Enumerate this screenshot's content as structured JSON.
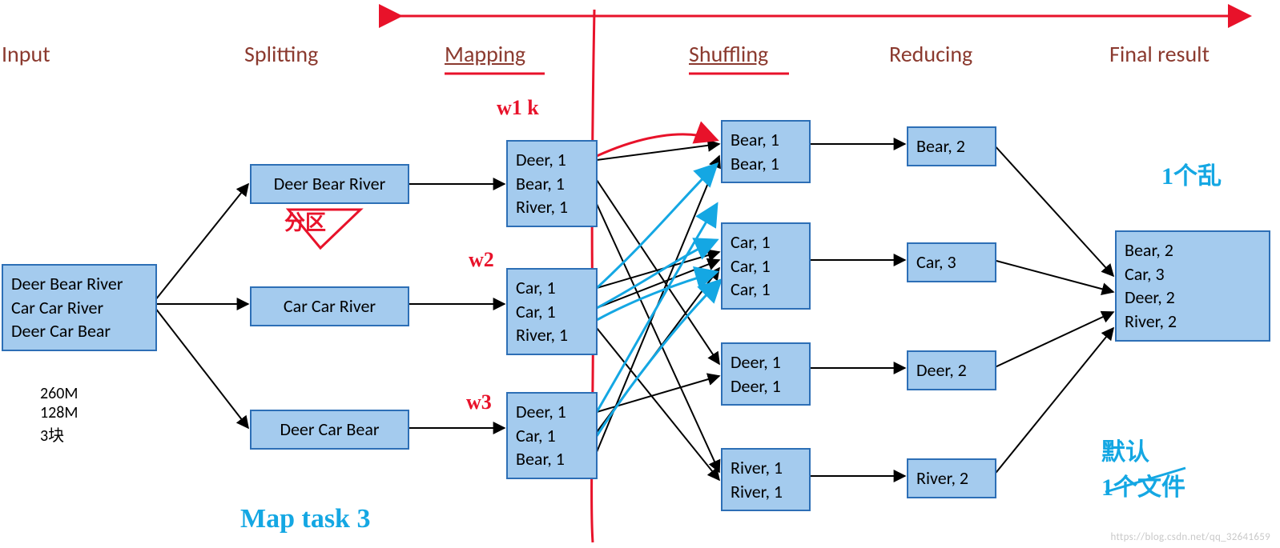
{
  "headers": {
    "input": "Input",
    "splitting": "Splitting",
    "mapping": "Mapping",
    "shuffling": "Shuffling",
    "reducing": "Reducing",
    "final": "Final result"
  },
  "boxes": {
    "input": "Deer Bear River\nCar Car River\nDeer Car Bear",
    "split1": "Deer Bear River",
    "split2": "Car Car River",
    "split3": "Deer Car Bear",
    "map1": "Deer, 1\nBear, 1\nRiver, 1",
    "map2": "Car, 1\nCar, 1\nRiver, 1",
    "map3": "Deer, 1\nCar, 1\nBear, 1",
    "shuf1": "Bear, 1\nBear, 1",
    "shuf2": "Car, 1\nCar, 1\nCar, 1",
    "shuf3": "Deer, 1\nDeer, 1",
    "shuf4": "River, 1\nRiver, 1",
    "red1": "Bear, 2",
    "red2": "Car, 3",
    "red3": "Deer, 2",
    "red4": "River, 2",
    "final": "Bear, 2\nCar, 3\nDeer, 2\nRiver, 2"
  },
  "notes": {
    "sizes": "260M\n128M\n3块"
  },
  "scribbles": {
    "w1": "w1   k",
    "w2": "w2",
    "w3": "w3",
    "fenxiang": "分区",
    "maptask": "Map task  3",
    "rightTop": "1个乱",
    "rightBottom": "默认\n1个文件"
  },
  "watermark": "https://blog.csdn.net/qq_32641659"
}
